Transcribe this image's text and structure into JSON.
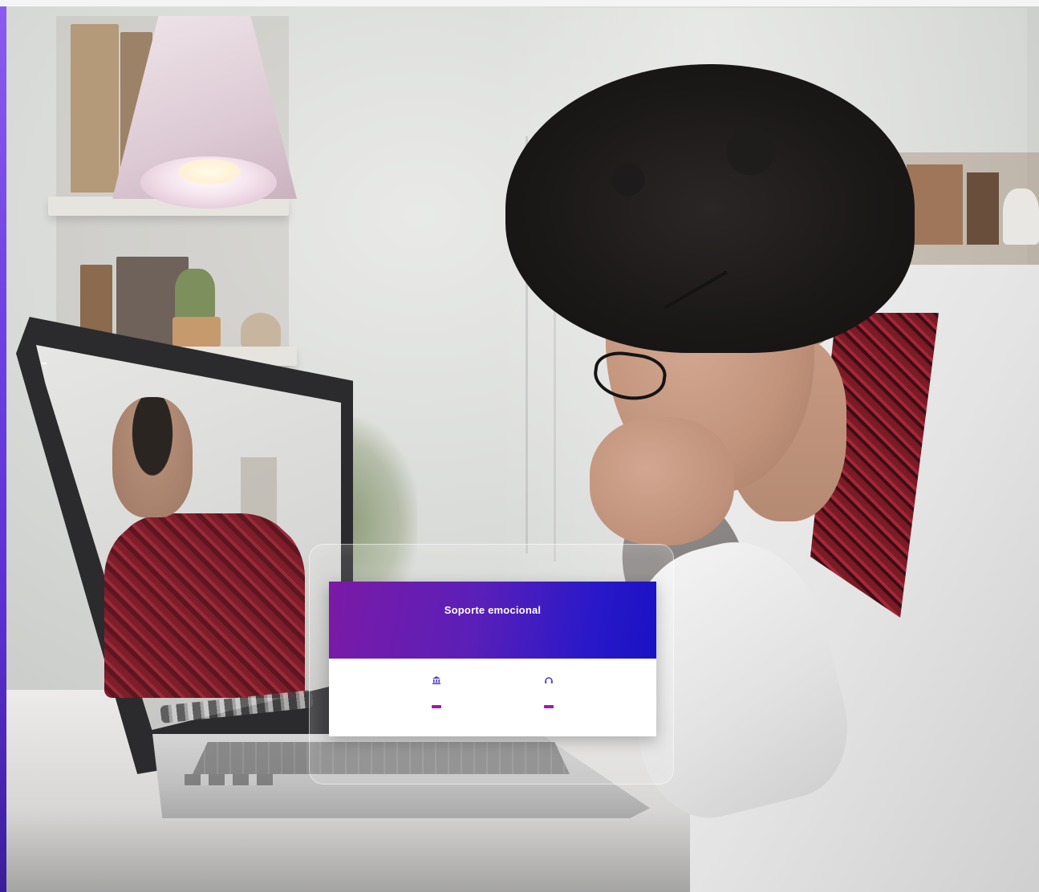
{
  "scene": {
    "laptop_screen_label": "",
    "brand_accent": "#7b1aa6",
    "hero_gradient_end": "#1a12c4",
    "button_color": "#a11aa8"
  },
  "card": {
    "title": "Soporte emocional",
    "description": "",
    "columns": [
      {
        "icon": "bank-icon",
        "title": "",
        "text": "",
        "button": ""
      },
      {
        "icon": "headset-icon",
        "title": "",
        "text": "",
        "button": ""
      }
    ]
  }
}
